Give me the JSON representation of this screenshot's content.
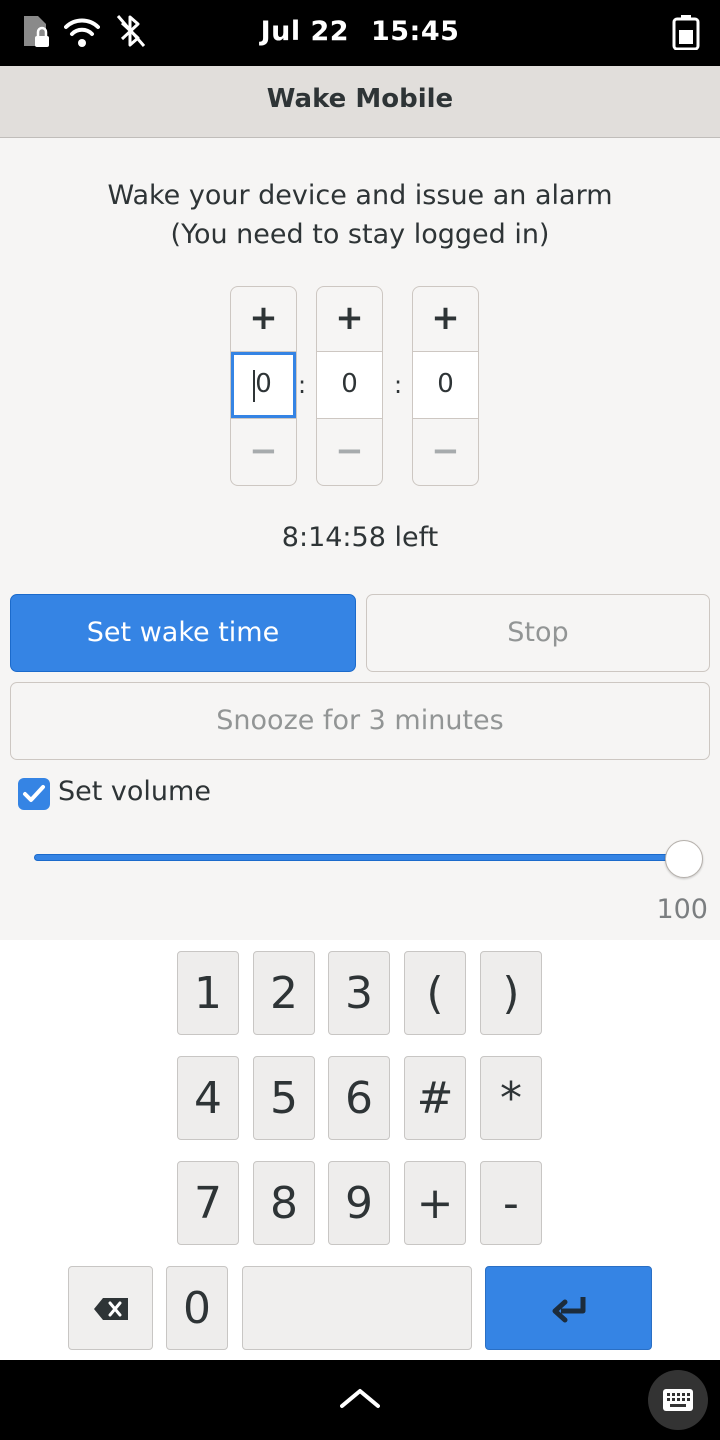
{
  "status_bar": {
    "date": "Jul 22",
    "time": "15:45",
    "icons": [
      "sim-locked-icon",
      "wifi-icon",
      "bluetooth-off-icon",
      "battery-icon"
    ]
  },
  "header": {
    "title": "Wake Mobile"
  },
  "description": {
    "line1": "Wake your device and issue an alarm",
    "line2": "(You need to stay logged in)"
  },
  "time_picker": {
    "plus_label": "+",
    "minus_label": "−",
    "separator": ":",
    "hours": "0",
    "minutes": "0",
    "seconds": "0"
  },
  "remaining": "8:14:58 left",
  "buttons": {
    "set_wake_time": "Set wake time",
    "stop": "Stop",
    "snooze": "Snooze for 3 minutes"
  },
  "volume": {
    "checkbox_label": "Set volume",
    "checked": true,
    "level": 100,
    "value_label": "100"
  },
  "keyboard": {
    "row1": [
      "1",
      "2",
      "3",
      "(",
      ")"
    ],
    "row2": [
      "4",
      "5",
      "6",
      "#",
      "*"
    ],
    "row3": [
      "7",
      "8",
      "9",
      "+",
      "-"
    ],
    "row4": [
      "0"
    ]
  },
  "colors": {
    "accent": "#3584e4",
    "header_bg": "#e1dedb",
    "content_bg": "#f6f5f4"
  }
}
